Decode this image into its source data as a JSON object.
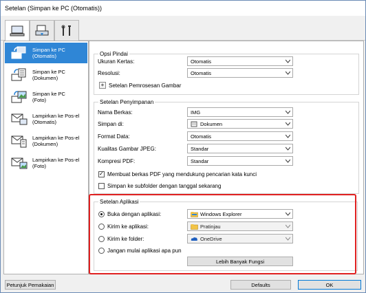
{
  "window": {
    "title": "Setelan (Simpan ke PC (Otomatis))"
  },
  "tabs": [
    {
      "icon": "computer-scan-icon"
    },
    {
      "icon": "scanner-icon"
    },
    {
      "icon": "tools-icon"
    }
  ],
  "sidebar": {
    "items": [
      {
        "label": "Simpan ke PC\n(Otomatis)",
        "icon": "auto-save-icon",
        "selected": true
      },
      {
        "label": "Simpan ke PC\n(Dokumen)",
        "icon": "document-save-icon",
        "selected": false
      },
      {
        "label": "Simpan ke PC\n(Foto)",
        "icon": "photo-save-icon",
        "selected": false
      },
      {
        "label": "Lampirkan ke Pos-el\n(Otomatis)",
        "icon": "email-auto-icon",
        "selected": false
      },
      {
        "label": "Lampirkan ke Pos-el\n(Dokumen)",
        "icon": "email-document-icon",
        "selected": false
      },
      {
        "label": "Lampirkan ke Pos-el\n(Foto)",
        "icon": "email-photo-icon",
        "selected": false
      }
    ]
  },
  "scan_options": {
    "title": "Opsi Pindai",
    "paper_size_label": "Ukuran Kertas:",
    "paper_size_value": "Otomatis",
    "resolution_label": "Resolusi:",
    "resolution_value": "Otomatis",
    "image_processing_label": "Setelan Pemrosesan Gambar"
  },
  "save_settings": {
    "title": "Setelan Penyimpanan",
    "file_name_label": "Nama Berkas:",
    "file_name_value": "IMG",
    "save_in_label": "Simpan di:",
    "save_in_value": "Dokumen",
    "data_format_label": "Format Data:",
    "data_format_value": "Otomatis",
    "jpeg_quality_label": "Kualitas Gambar JPEG:",
    "jpeg_quality_value": "Standar",
    "pdf_compression_label": "Kompresi PDF:",
    "pdf_compression_value": "Standar",
    "searchable_pdf_label": "Membuat berkas PDF yang mendukung pencarian kata kunci",
    "searchable_pdf_checked": true,
    "subfolder_label": "Simpan ke subfolder dengan tanggal sekarang",
    "subfolder_checked": false
  },
  "app_settings": {
    "title": "Setelan Aplikasi",
    "open_with_label": "Buka dengan aplikasi:",
    "open_with_value": "Windows Explorer",
    "send_app_label": "Kirim ke aplikasi:",
    "send_app_value": "Pratinjau",
    "send_folder_label": "Kirim ke folder:",
    "send_folder_value": "OneDrive",
    "no_app_label": "Jangan mulai aplikasi apa pun",
    "more_functions_label": "Lebih Banyak Fungsi",
    "selected_option": "open_with"
  },
  "footer": {
    "instructions_label": "Petunjuk Pemakaian",
    "defaults_label": "Defaults",
    "ok_label": "OK"
  },
  "colors": {
    "selection": "#2f86d6",
    "highlight": "#e02020"
  }
}
